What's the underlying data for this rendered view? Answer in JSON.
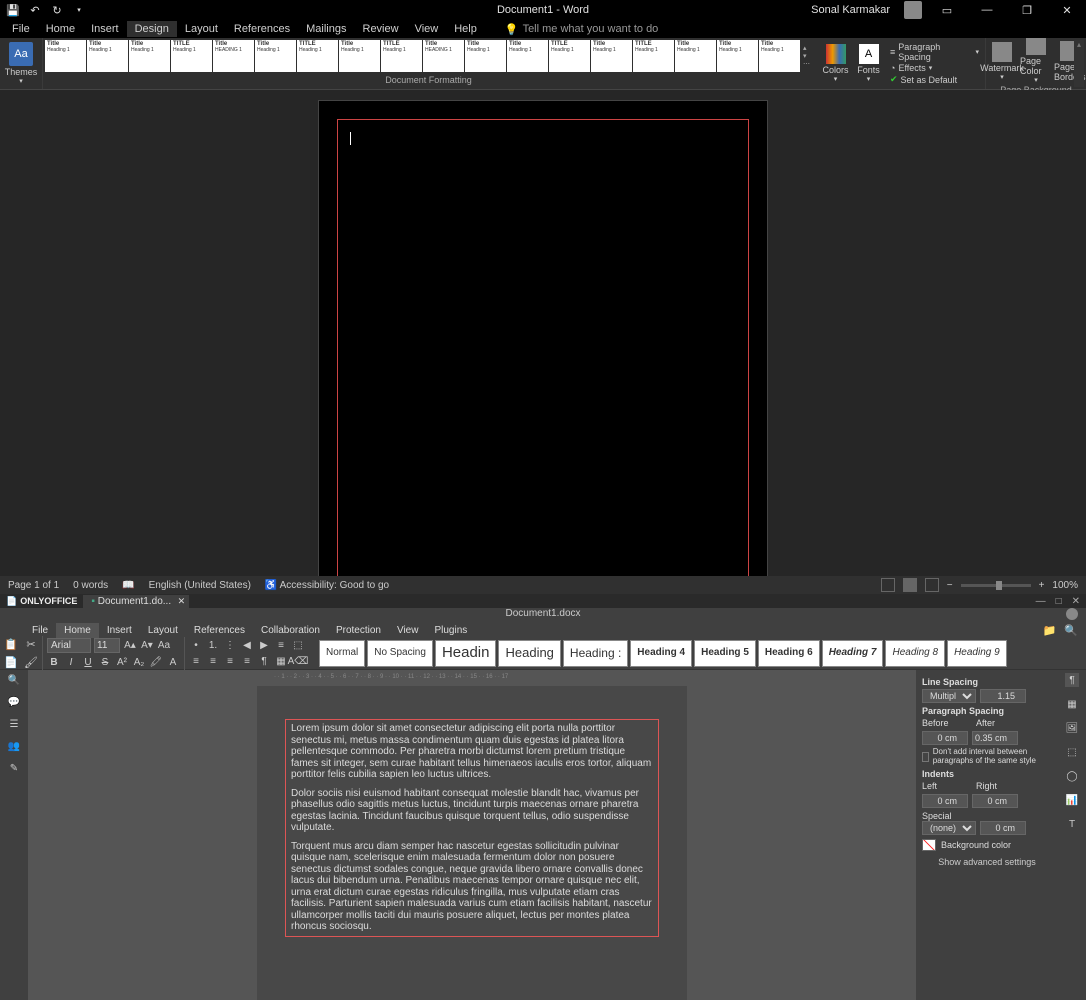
{
  "word": {
    "title": "Document1  -  Word",
    "user": "Sonal Karmakar",
    "menu": [
      "File",
      "Home",
      "Insert",
      "Design",
      "Layout",
      "References",
      "Mailings",
      "Review",
      "View",
      "Help"
    ],
    "activeMenu": "Design",
    "tellme": "Tell me what you want to do",
    "themes": "Themes",
    "documentFormatting": "Document Formatting",
    "colors": "Colors",
    "fonts": "Fonts",
    "paraSpacing": "Paragraph Spacing",
    "effects": "Effects",
    "setDefault": "Set as Default",
    "watermark": "Watermark",
    "pageColor": "Page Color",
    "pageBorders": "Page Borders",
    "pageBackground": "Page Background",
    "status": {
      "page": "Page 1 of 1",
      "words": "0 words",
      "lang": "English (United States)",
      "access": "Accessibility: Good to go",
      "zoom": "100%"
    },
    "styleThumbs": [
      "Title",
      "Title",
      "Title",
      "TITLE",
      "Title",
      "Title",
      "TITLE",
      "Title",
      "TITLE",
      "Title",
      "Title",
      "Title",
      "TITLE",
      "Title",
      "TITLE",
      "Title",
      "Title",
      "Title"
    ]
  },
  "oo": {
    "brand": "ONLYOFFICE",
    "tab": "Document1.do...",
    "title": "Document1.docx",
    "menu": [
      "File",
      "Home",
      "Insert",
      "Layout",
      "References",
      "Collaboration",
      "Protection",
      "View",
      "Plugins"
    ],
    "activeMenu": "Home",
    "font": "Arial",
    "fontSize": "11",
    "styles": [
      "Normal",
      "No Spacing",
      "Headin",
      "Heading",
      "Heading :",
      "Heading 4",
      "Heading 5",
      "Heading 6",
      "Heading 7",
      "Heading 8",
      "Heading 9"
    ],
    "p1": "Lorem ipsum dolor sit amet consectetur adipiscing elit porta nulla porttitor senectus mi, metus massa condimentum quam duis egestas id platea litora pellentesque commodo. Per pharetra morbi dictumst lorem pretium tristique fames sit integer, sem curae habitant tellus himenaeos iaculis eros tortor, aliquam porttitor felis cubilia sapien leo luctus ultrices.",
    "p2": "Dolor sociis nisi euismod habitant consequat molestie blandit hac, vivamus per phasellus odio sagittis metus luctus, tincidunt turpis maecenas ornare pharetra egestas lacinia. Tincidunt faucibus quisque torquent tellus, odio suspendisse vulputate.",
    "p3": "Torquent mus arcu diam semper hac nascetur egestas sollicitudin pulvinar quisque nam, scelerisque enim malesuada fermentum dolor non posuere senectus dictumst sodales congue, neque gravida libero ornare convallis donec lacus dui bibendum urna. Penatibus maecenas tempor ornare quisque nec elit, urna erat dictum curae egestas ridiculus fringilla, mus vulputate etiam cras facilisis. Parturient sapien malesuada varius cum etiam facilisis habitant, nascetur ullamcorper mollis taciti dui mauris posuere aliquet, lectus per montes platea rhoncus sociosqu.",
    "props": {
      "lineSpacing": "Line Spacing",
      "lineSpacingMode": "Multiple",
      "lineSpacingVal": "1.15",
      "paraSpacing": "Paragraph Spacing",
      "before": "Before",
      "after": "After",
      "beforeVal": "0 cm",
      "afterVal": "0.35 cm",
      "noInterval": "Don't add interval between paragraphs of the same style",
      "indents": "Indents",
      "left": "Left",
      "right": "Right",
      "leftVal": "0 cm",
      "rightVal": "0 cm",
      "special": "Special",
      "specialMode": "(none)",
      "specialVal": "0 cm",
      "bgColor": "Background color",
      "advanced": "Show advanced settings"
    }
  }
}
